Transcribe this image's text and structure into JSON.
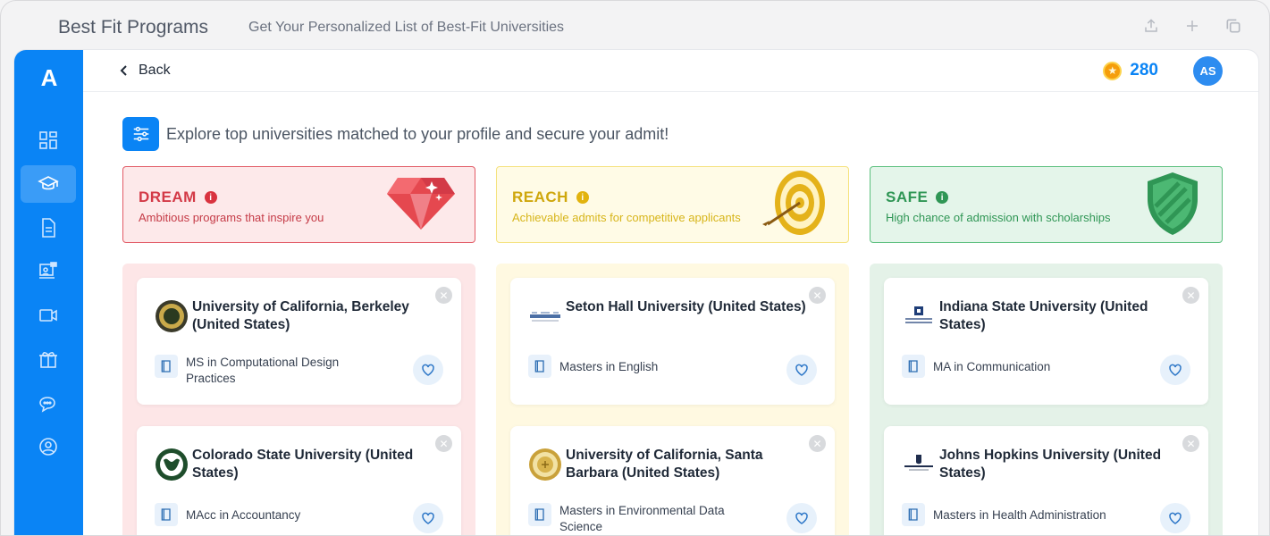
{
  "window": {
    "app_title": "Best Fit Programs",
    "subtitle": "Get Your Personalized List of Best-Fit Universities",
    "icons": [
      "share-icon",
      "plus-icon",
      "duplicate-icon"
    ]
  },
  "sidebar": {
    "logo": "A",
    "items": [
      {
        "name": "dashboard",
        "icon": "grid-icon",
        "active": false
      },
      {
        "name": "programs",
        "icon": "graduation-cap-icon",
        "active": true
      },
      {
        "name": "documents",
        "icon": "document-icon",
        "active": false
      },
      {
        "name": "classroom",
        "icon": "presentation-icon",
        "active": false
      },
      {
        "name": "video",
        "icon": "video-icon",
        "active": false
      },
      {
        "name": "rewards",
        "icon": "gift-icon",
        "active": false
      },
      {
        "name": "chat",
        "icon": "chat-icon",
        "active": false
      },
      {
        "name": "profile",
        "icon": "user-icon",
        "active": false
      }
    ]
  },
  "header": {
    "back_label": "Back",
    "coins": "280",
    "avatar_initials": "AS"
  },
  "intro": {
    "text": "Explore top universities matched to your profile and secure your admit!"
  },
  "categories": {
    "dream": {
      "title": "DREAM",
      "desc": "Ambitious programs that inspire you",
      "color": "#d33a47"
    },
    "reach": {
      "title": "REACH",
      "desc": "Achievable admits for competitive applicants",
      "color": "#cfa70c"
    },
    "safe": {
      "title": "SAFE",
      "desc": "High chance of admission with scholarships",
      "color": "#2f9655"
    }
  },
  "columns": {
    "dream": [
      {
        "university": "University of California, Berkeley (United States)",
        "program": "MS in Computational Design Practices"
      },
      {
        "university": "Colorado State University (United States)",
        "program": "MAcc in Accountancy"
      }
    ],
    "reach": [
      {
        "university": "Seton Hall University (United States)",
        "program": "Masters in English"
      },
      {
        "university": "University of California, Santa Barbara (United States)",
        "program": "Masters in Environmental Data Science"
      }
    ],
    "safe": [
      {
        "university": "Indiana State University (United States)",
        "program": "MA in Communication"
      },
      {
        "university": "Johns Hopkins University (United States)",
        "program": "Masters in Health Administration"
      }
    ]
  }
}
